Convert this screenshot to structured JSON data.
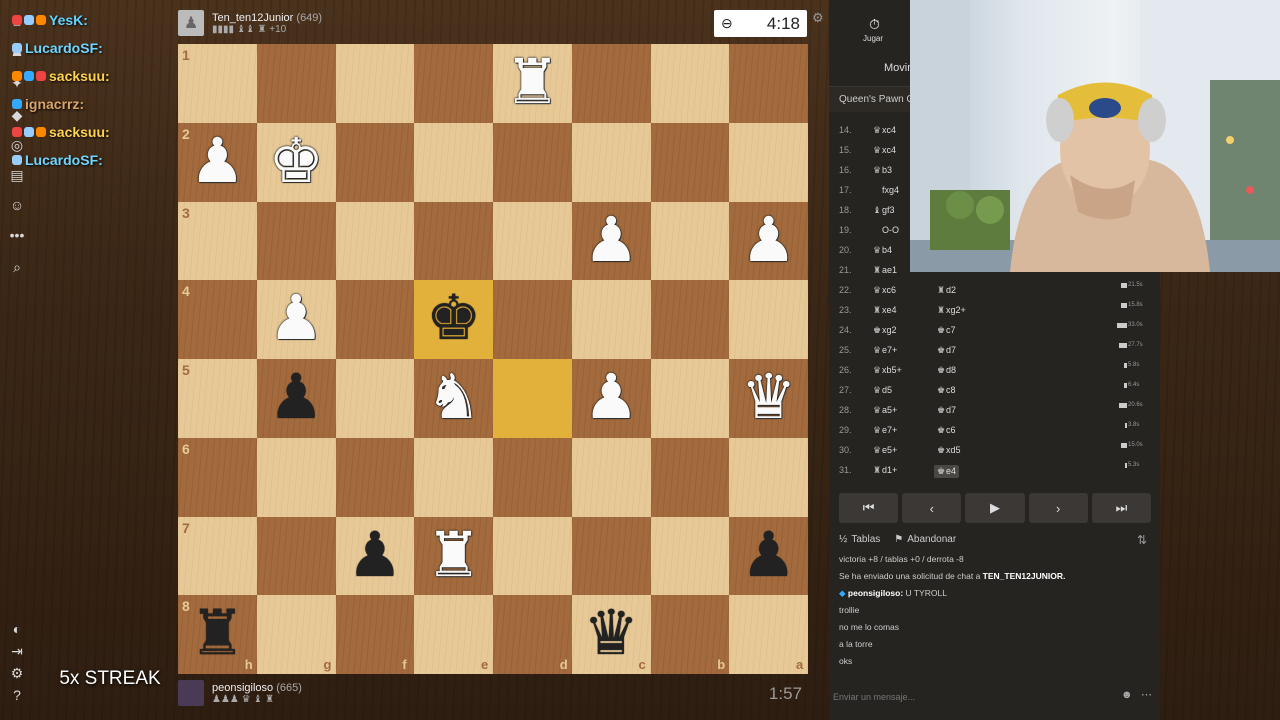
{
  "overlay_chat": [
    {
      "user": "YesK:",
      "color": "#63d2ff"
    },
    {
      "user": "LucardoSF:",
      "color": "#6fd6ff"
    },
    {
      "user": "sacksuu:",
      "color": "#ffd34d"
    },
    {
      "user": "ignacrrz:",
      "color": "#d9a36a"
    },
    {
      "user": "sacksuu:",
      "color": "#ffd34d"
    },
    {
      "user": "LucardoSF:",
      "color": "#6fd6ff"
    }
  ],
  "top_player": {
    "name": "Ten_ten12Junior",
    "rating": "(649)",
    "material": "▮▮▮▮ ♝♝ ♜ +10"
  },
  "bottom_player": {
    "name": "peonsigiloso",
    "rating": "(665)",
    "material": "♟♟♟ ♛ ♝ ♜"
  },
  "clocks": {
    "top": "4:18",
    "bottom": "1:57"
  },
  "board": {
    "rank_labels": [
      "1",
      "2",
      "3",
      "4",
      "5",
      "6",
      "7",
      "8"
    ],
    "file_labels": [
      "h",
      "g",
      "f",
      "e",
      "d",
      "c",
      "b",
      "a"
    ],
    "pieces": [
      {
        "glyph": "♜",
        "color": "white",
        "file": 4,
        "rank": 0
      },
      {
        "glyph": "♟",
        "color": "white",
        "file": 0,
        "rank": 1
      },
      {
        "glyph": "♚",
        "color": "white",
        "file": 1,
        "rank": 1
      },
      {
        "glyph": "♟",
        "color": "white",
        "file": 5,
        "rank": 2
      },
      {
        "glyph": "♟",
        "color": "white",
        "file": 7,
        "rank": 2
      },
      {
        "glyph": "♟",
        "color": "white",
        "file": 1,
        "rank": 3
      },
      {
        "glyph": "♚",
        "color": "black",
        "file": 3,
        "rank": 3
      },
      {
        "glyph": "♟",
        "color": "black",
        "file": 1,
        "rank": 4
      },
      {
        "glyph": "♞",
        "color": "white",
        "file": 3,
        "rank": 4
      },
      {
        "glyph": "♟",
        "color": "white",
        "file": 5,
        "rank": 4
      },
      {
        "glyph": "♛",
        "color": "white",
        "file": 7,
        "rank": 4
      },
      {
        "glyph": "♟",
        "color": "black",
        "file": 2,
        "rank": 6
      },
      {
        "glyph": "♜",
        "color": "white",
        "file": 3,
        "rank": 6
      },
      {
        "glyph": "♟",
        "color": "black",
        "file": 7,
        "rank": 6
      },
      {
        "glyph": "♜",
        "color": "black",
        "file": 0,
        "rank": 7
      },
      {
        "glyph": "♛",
        "color": "black",
        "file": 5,
        "rank": 7
      }
    ],
    "highlights": [
      {
        "file": 3,
        "rank": 3
      },
      {
        "file": 4,
        "rank": 4
      }
    ]
  },
  "right_panel": {
    "play_label": "Jugar",
    "moves_tab": "Movim",
    "opening": "Queen's Pawn Ope",
    "moves": [
      {
        "n": "14.",
        "w": "xc4",
        "wp": "♛",
        "b": "",
        "bp": "",
        "bar": 14,
        "t": ""
      },
      {
        "n": "15.",
        "w": "xc4",
        "wp": "♛",
        "b": "",
        "bp": "",
        "bar": 0,
        "t": ""
      },
      {
        "n": "16.",
        "w": "b3",
        "wp": "♛",
        "b": "",
        "bp": "",
        "bar": 0,
        "t": ""
      },
      {
        "n": "17.",
        "w": "fxg4",
        "wp": "",
        "b": "",
        "bp": "",
        "bar": 0,
        "t": ""
      },
      {
        "n": "18.",
        "w": "gf3",
        "wp": "♝",
        "b": "",
        "bp": "",
        "bar": 0,
        "t": ""
      },
      {
        "n": "19.",
        "w": "O-O",
        "wp": "",
        "b": "",
        "bp": "",
        "bar": 0,
        "t": ""
      },
      {
        "n": "20.",
        "w": "b4",
        "wp": "♛",
        "b": "",
        "bp": "",
        "bar": 0,
        "t": ""
      },
      {
        "n": "21.",
        "w": "ae1",
        "wp": "♜",
        "b": "",
        "bp": "",
        "bar": 4,
        "t": "28.4s"
      },
      {
        "n": "22.",
        "w": "xc6",
        "wp": "♛",
        "b": "d2",
        "bp": "♜",
        "bar": 6,
        "t": "21.5s"
      },
      {
        "n": "23.",
        "w": "xe4",
        "wp": "♜",
        "b": "xg2+",
        "bp": "♜",
        "bar": 6,
        "t": "15.8s"
      },
      {
        "n": "24.",
        "w": "xg2",
        "wp": "♚",
        "b": "c7",
        "bp": "♚",
        "bar": 10,
        "t": "33.0s"
      },
      {
        "n": "25.",
        "w": "e7+",
        "wp": "♛",
        "b": "d7",
        "bp": "♚",
        "bar": 8,
        "t": "27.7s"
      },
      {
        "n": "26.",
        "w": "xb5+",
        "wp": "♛",
        "b": "d8",
        "bp": "♚",
        "bar": 3,
        "t": "5.8s"
      },
      {
        "n": "27.",
        "w": "d5",
        "wp": "♛",
        "b": "c8",
        "bp": "♚",
        "bar": 3,
        "t": "6.4s"
      },
      {
        "n": "28.",
        "w": "a5+",
        "wp": "♛",
        "b": "d7",
        "bp": "♚",
        "bar": 8,
        "t": "20.6s"
      },
      {
        "n": "29.",
        "w": "e7+",
        "wp": "♛",
        "b": "c6",
        "bp": "♚",
        "bar": 2,
        "t": "3.8s"
      },
      {
        "n": "30.",
        "w": "e5+",
        "wp": "♛",
        "b": "xd5",
        "bp": "♚",
        "bar": 6,
        "t": "15.0s"
      },
      {
        "n": "31.",
        "w": "d1+",
        "wp": "♜",
        "b": "e4",
        "bp": "♚",
        "bar": 2,
        "t": "5.3s"
      }
    ],
    "controls": [
      "⏮",
      "‹",
      "▶",
      "›",
      "⏭"
    ],
    "draw_label": "Tablas",
    "resign_label": "Abandonar",
    "chat_log": [
      {
        "text": "victoria +8 / tablas +0 / derrota -8"
      },
      {
        "text": "Se ha enviado una solicitud de chat a ",
        "bold": "TEN_TEN12JUNIOR."
      },
      {
        "text": "",
        "bold": "peonsigiloso:",
        "after": " U TYROLL"
      },
      {
        "text": "trollie"
      },
      {
        "text": "no me lo comas"
      },
      {
        "text": "a la torre"
      },
      {
        "text": "oks"
      }
    ],
    "chat_placeholder": "Enviar un mensaje..."
  },
  "streak_text": "5x STREAK"
}
